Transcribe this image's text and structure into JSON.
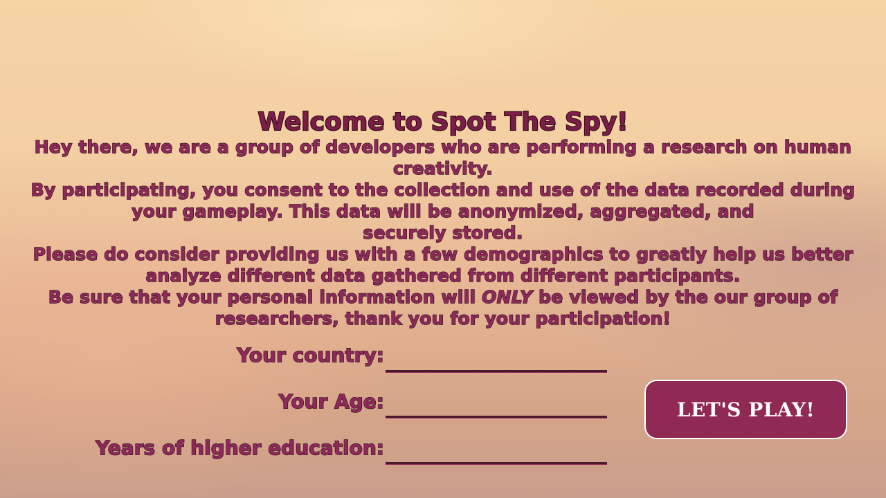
{
  "title": "Welcome to Spot The Spy!",
  "intro": {
    "p1": "Hey there, we are a group of developers who are performing a research on human creativity.",
    "p2a": "By participating, you consent to the collection and use of the data recorded during your gameplay. This data will be anonymized, aggregated, and",
    "p2b": "securely stored.",
    "p3": "Please do consider providing us with a few demographics to greatly help us better analyze different data gathered from different participants.",
    "p4_before": "Be sure that your personal information will ",
    "p4_emph": "ONLY",
    "p4_after": " be viewed by the our group of researchers, thank you for your participation!"
  },
  "form": {
    "country_label": "Your country:",
    "country_value": "",
    "age_label": "Your Age:",
    "age_value": "",
    "education_label": "Years of higher education:",
    "education_value": ""
  },
  "play_button": {
    "label": "LET'S PLAY!"
  },
  "colors": {
    "text_fill": "#8e2a5a",
    "text_outline": "#3a0f22",
    "button_bg": "#902a55",
    "button_border": "#ffffff"
  }
}
